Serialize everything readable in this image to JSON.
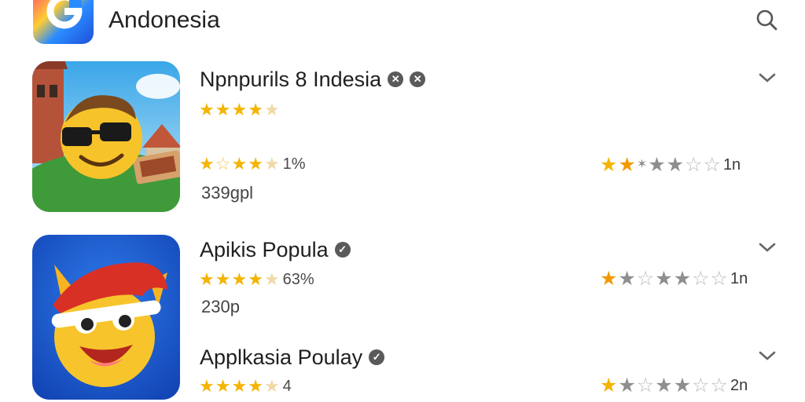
{
  "header": {
    "app_title": "Andonesia",
    "logo_icon": "app-logo-icon",
    "search_icon": "search-icon"
  },
  "colors": {
    "star_gold": "#f4b400",
    "star_grey": "#8e8e8e",
    "badge": "#5a5a5a"
  },
  "apps": [
    {
      "name": "Npnpurils 8 Indesia",
      "rating_stars": "★★★★☆",
      "rating_text": "1%",
      "size": "339gpl",
      "right_rating_text": "1n",
      "right_rating_fraction": 0.35
    },
    {
      "name": "Apikis Popula",
      "rating_text": "63%",
      "size": "230p",
      "right_rating_text": "1n"
    },
    {
      "name": "Applkasia Poulay",
      "rating_text": "4",
      "right_rating_text": "2n"
    }
  ]
}
